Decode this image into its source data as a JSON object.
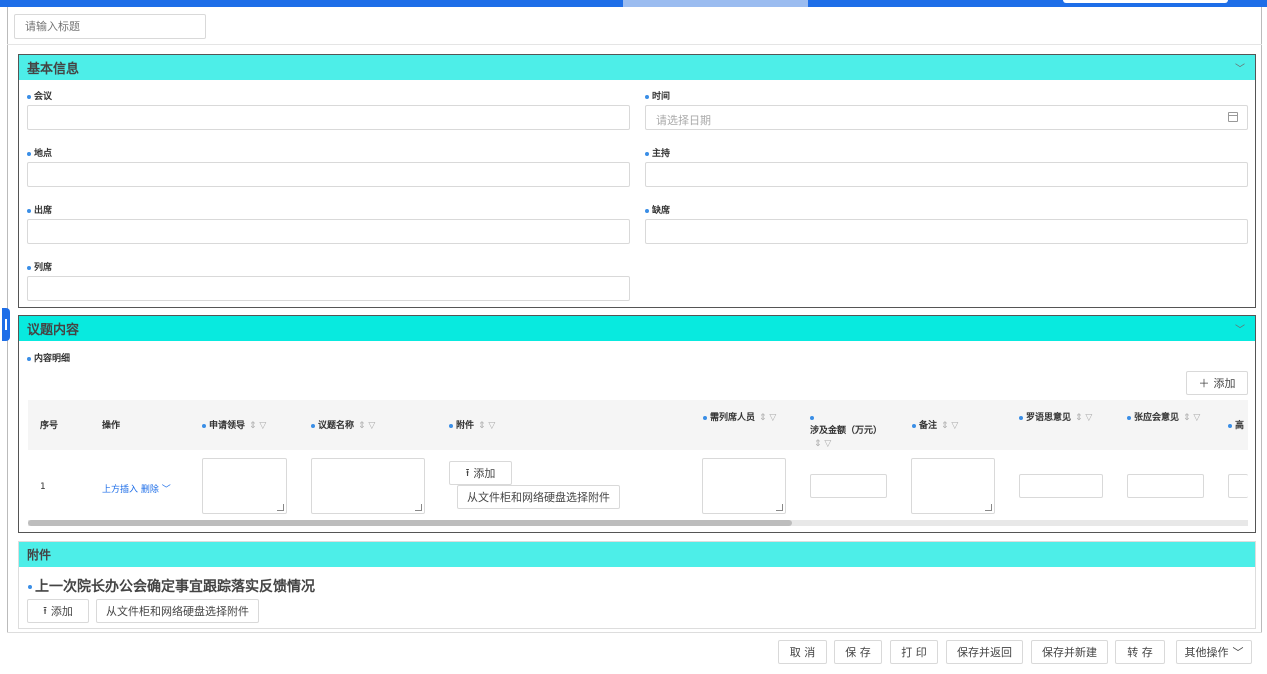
{
  "title_placeholder": "请输入标题",
  "sections": {
    "basic": {
      "title": "基本信息",
      "fields": {
        "meeting": "会议",
        "time": "时间",
        "time_placeholder": "请选择日期",
        "location": "地点",
        "host": "主持",
        "attendees": "出席",
        "absent": "缺席",
        "observers": "列席"
      }
    },
    "agenda": {
      "title": "议题内容",
      "detail_label": "内容明细",
      "add_label": "添加",
      "columns": [
        "序号",
        "操作",
        "申请领导",
        "议题名称",
        "附件",
        "需列席人员",
        "涉及金额（万元）",
        "备注",
        "罗语思意见",
        "张应会意见",
        "高"
      ],
      "row": {
        "index": "1",
        "insert_above": "上方插入",
        "delete": "删除",
        "upload_label": "添加",
        "choose_from_cabinet": "从文件柜和网络硬盘选择附件"
      }
    },
    "attachments": {
      "title": "附件",
      "item_title": "上一次院长办公会确定事宜跟踪落实反馈情况",
      "upload_label": "添加",
      "choose_from_cabinet": "从文件柜和网络硬盘选择附件"
    }
  },
  "footer": {
    "cancel": "取 消",
    "save": "保 存",
    "print": "打 印",
    "save_return": "保存并返回",
    "save_new": "保存并新建",
    "transfer": "转 存",
    "other": "其他操作"
  },
  "colors": {
    "accent": "#1e6ee8",
    "section_header": "#4deee8",
    "section_header_alt": "#08eadf"
  }
}
